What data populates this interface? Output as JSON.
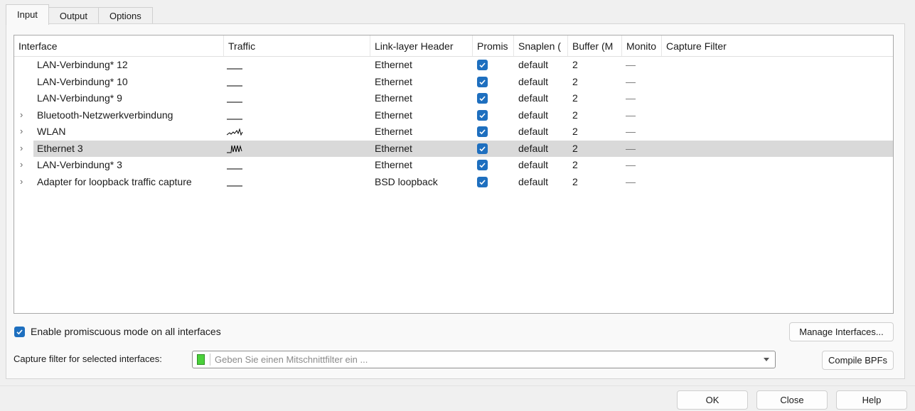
{
  "tabs": [
    {
      "label": "Input",
      "active": true
    },
    {
      "label": "Output",
      "active": false
    },
    {
      "label": "Options",
      "active": false
    }
  ],
  "table": {
    "columns": [
      "Interface",
      "Traffic",
      "Link-layer Header",
      "Promis",
      "Snaplen (",
      "Buffer (M",
      "Monito",
      "Capture Filter"
    ],
    "rows": [
      {
        "name": "LAN-Verbindung* 12",
        "expandable": false,
        "traffic_icon": "flat-sparkline",
        "link": "Ethernet",
        "promisc": true,
        "snaplen": "default",
        "buffer": "2",
        "monitor": "—",
        "selected": false
      },
      {
        "name": "LAN-Verbindung* 10",
        "expandable": false,
        "traffic_icon": "flat-sparkline",
        "link": "Ethernet",
        "promisc": true,
        "snaplen": "default",
        "buffer": "2",
        "monitor": "—",
        "selected": false
      },
      {
        "name": "LAN-Verbindung* 9",
        "expandable": false,
        "traffic_icon": "flat-sparkline",
        "link": "Ethernet",
        "promisc": true,
        "snaplen": "default",
        "buffer": "2",
        "monitor": "—",
        "selected": false
      },
      {
        "name": "Bluetooth-Netzwerkverbindung",
        "expandable": true,
        "traffic_icon": "flat-sparkline",
        "link": "Ethernet",
        "promisc": true,
        "snaplen": "default",
        "buffer": "2",
        "monitor": "—",
        "selected": false
      },
      {
        "name": "WLAN",
        "expandable": true,
        "traffic_icon": "active-sparkline",
        "link": "Ethernet",
        "promisc": true,
        "snaplen": "default",
        "buffer": "2",
        "monitor": "—",
        "selected": false
      },
      {
        "name": "Ethernet 3",
        "expandable": true,
        "traffic_icon": "busy-sparkline",
        "link": "Ethernet",
        "promisc": true,
        "snaplen": "default",
        "buffer": "2",
        "monitor": "—",
        "selected": true
      },
      {
        "name": "LAN-Verbindung* 3",
        "expandable": true,
        "traffic_icon": "flat-sparkline",
        "link": "Ethernet",
        "promisc": true,
        "snaplen": "default",
        "buffer": "2",
        "monitor": "—",
        "selected": false
      },
      {
        "name": "Adapter for loopback traffic capture",
        "expandable": true,
        "traffic_icon": "flat-sparkline",
        "link": "BSD loopback",
        "promisc": true,
        "snaplen": "default",
        "buffer": "2",
        "monitor": "—",
        "selected": false
      }
    ]
  },
  "promisc_all": {
    "label": "Enable promiscuous mode on all interfaces",
    "checked": true
  },
  "manage_button": "Manage Interfaces...",
  "capture_filter": {
    "label": "Capture filter for selected interfaces:",
    "placeholder": "Geben Sie einen Mitschnittfilter ein ..."
  },
  "compile_button": "Compile BPFs",
  "dialog_buttons": {
    "ok": "OK",
    "close": "Close",
    "help": "Help"
  },
  "colors": {
    "accent": "#1e6fbf",
    "selected_row": "#d9d9d9",
    "bookmark": "#4bd13b"
  }
}
